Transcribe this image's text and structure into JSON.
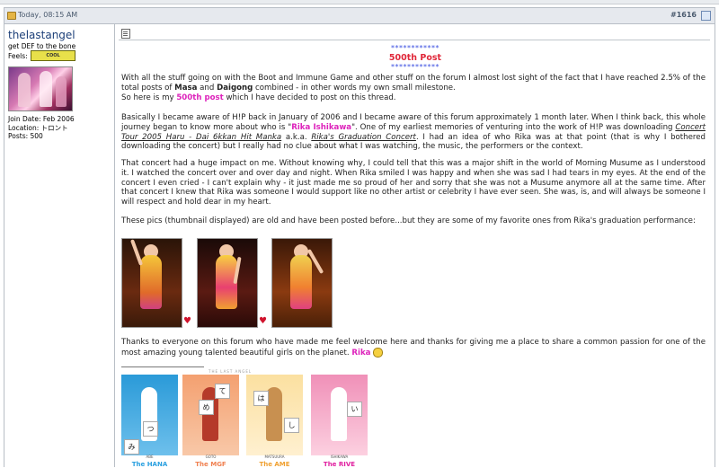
{
  "post": {
    "date": "Today, 08:15 AM",
    "number": "#1616"
  },
  "user": {
    "name": "thelastangel",
    "title": "get DEF to the bone",
    "feels_label": "Feels:",
    "feels_badge": "COOL",
    "join_date": "Join Date: Feb 2006",
    "location": "Location: トロント",
    "posts": "Posts: 500"
  },
  "message": {
    "stars": "************",
    "headline": "500th Post",
    "p1": "With all the stuff going on with the Boot and Immune Game and other stuff on the forum I almost lost sight of the fact that I have reached 2.5% of the total posts of ",
    "masa": "Masa",
    "and": " and ",
    "daigong": "Daigong",
    "p1b": " combined - in other words my own small milestone.",
    "p2a": "So here is my ",
    "p2link": "500th post",
    "p2b": " which I have decided to post on this thread.",
    "p3a": "Basically I became aware of H!P back in January of 2006 and I became aware of this forum approximately 1 month later. When I think back, this whole journey began to know more about who is \"",
    "p3name": "Rika Ishikawa",
    "p3b": "\". One of my earliest memories of venturing into the work of H!P was downloading ",
    "p3title1": "Concert Tour 2005 Haru - Dai 6kkan Hit Manka",
    "p3c": " a.k.a. ",
    "p3title2": "Rika's Graduation Concert",
    "p3d": ". I had an idea of who Rika was at that point (that is why I bothered downloading the concert) but I really had no clue about what I was watching, the music, the performers or the context.",
    "p4": "That concert had a huge impact on me. Without knowing why, I could tell that this was a major shift in the world of Morning Musume as I understood it. I watched the concert over and over day and night. When Rika smiled I was happy and when she was sad I had tears in my eyes. At the end of the concert I even cried - I can't explain why - it just made me so proud of her and sorry that she was not a Musume anymore all at the same time. After that concert I knew that Rika was someone I would support like no other artist or celebrity I have ever seen. She was, is, and will always be someone I will respect and hold dear in my heart.",
    "p5": "These pics (thumbnail displayed) are old and have been posted before...but they are some of my favorite ones from Rika's graduation performance:",
    "p6": "Thanks to everyone on this forum who have made me feel welcome here and thanks for giving me a place to share a common passion for one of the most amazing young talented beautiful girls on the planet. ",
    "p6name": "Rika"
  },
  "signature": {
    "banner_title": "THE LAST ANGEL",
    "cards": [
      {
        "name": "ABE",
        "label": "The HANA",
        "color": "#2aa0e0"
      },
      {
        "name": "GOTO",
        "label": "The MGF",
        "color": "#f08050"
      },
      {
        "name": "MATSUURA",
        "label": "The AME",
        "color": "#f0a030"
      },
      {
        "name": "ISHIKAWA",
        "label": "The RIVE",
        "color": "#e020a0"
      }
    ],
    "kana": [
      "み",
      "つ",
      "め",
      "て",
      "は",
      "し",
      "い"
    ]
  },
  "colors": {
    "username": "#1c3f78",
    "headline": "#e0283a",
    "pink_link": "#dd22bb",
    "border": "#b8bec6"
  }
}
